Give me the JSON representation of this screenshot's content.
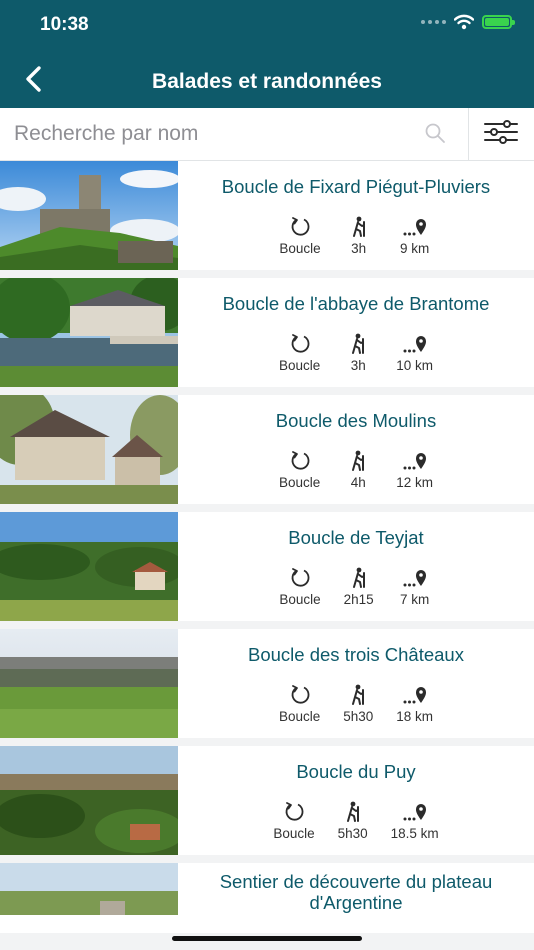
{
  "status": {
    "time": "10:38"
  },
  "header": {
    "title": "Balades et randonnées"
  },
  "search": {
    "placeholder": "Recherche par nom"
  },
  "walks": [
    {
      "name": "Boucle de Fixard Piégut-Pluviers",
      "type": "Boucle",
      "duration": "3h",
      "distance": "9 km"
    },
    {
      "name": "Boucle de l'abbaye de Brantome",
      "type": "Boucle",
      "duration": "3h",
      "distance": "10 km"
    },
    {
      "name": "Boucle des Moulins",
      "type": "Boucle",
      "duration": "4h",
      "distance": "12 km"
    },
    {
      "name": "Boucle de Teyjat",
      "type": "Boucle",
      "duration": "2h15",
      "distance": "7 km"
    },
    {
      "name": "Boucle des trois Châteaux",
      "type": "Boucle",
      "duration": "5h30",
      "distance": "18 km"
    },
    {
      "name": "Boucle du Puy",
      "type": "Boucle",
      "duration": "5h30",
      "distance": "18.5 km"
    },
    {
      "name": "Sentier de découverte du plateau d'Argentine"
    }
  ],
  "colors": {
    "header": "#0e5a6a",
    "title_text": "#0e5a6a",
    "battery": "#39d44d"
  }
}
